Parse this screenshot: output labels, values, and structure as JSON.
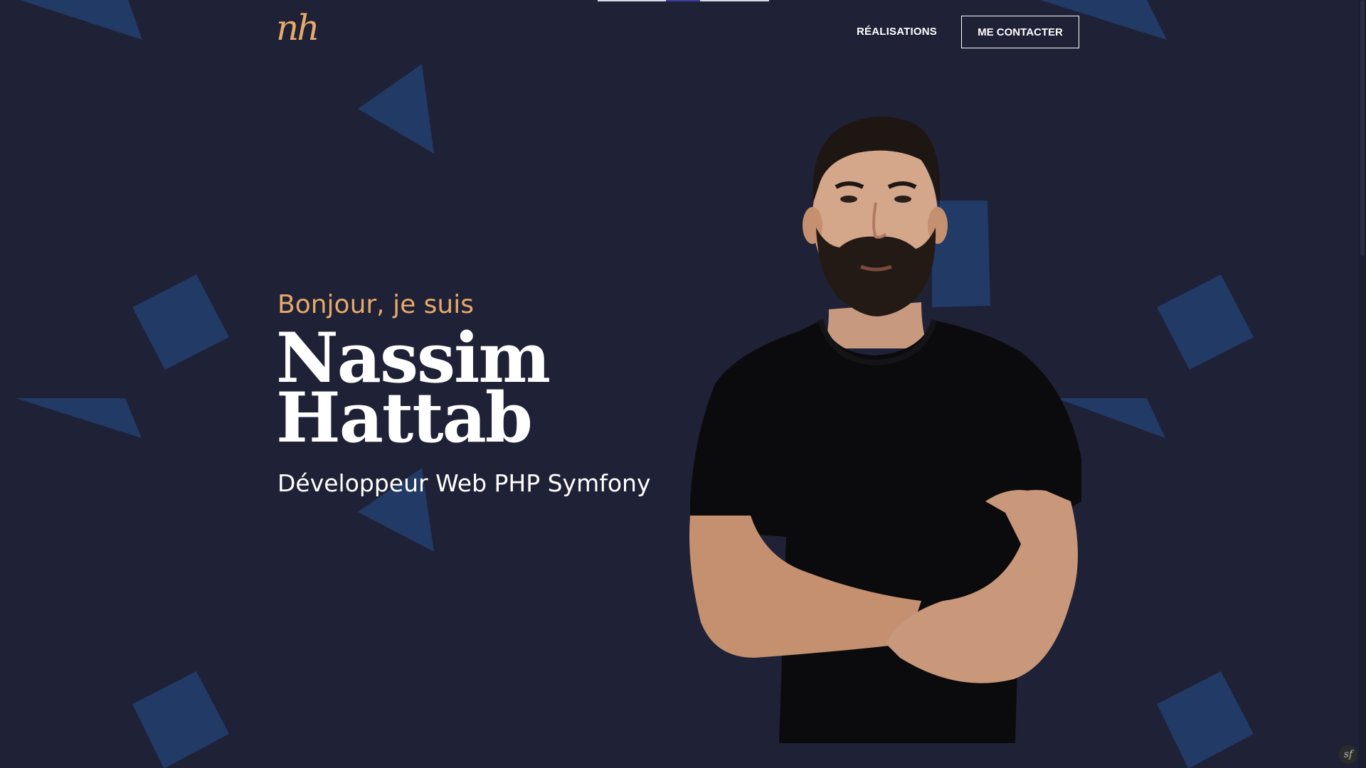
{
  "header": {
    "logo_text": "nh",
    "nav": [
      {
        "label": "RÉALISATIONS"
      }
    ],
    "contact_button_label": "ME CONTACTER"
  },
  "hero": {
    "greeting": "Bonjour, je suis",
    "first_name": "Nassim",
    "last_name": "Hattab",
    "role": "Développeur Web PHP Symfony"
  },
  "portrait": {
    "icon": "person-portrait-photo"
  },
  "debug_toolbar": {
    "label": "sf",
    "icon": "symfony-icon"
  },
  "colors": {
    "background": "#1f2136",
    "accent": "#e7a96a",
    "shapes": "#213a66",
    "text": "#ffffff"
  }
}
